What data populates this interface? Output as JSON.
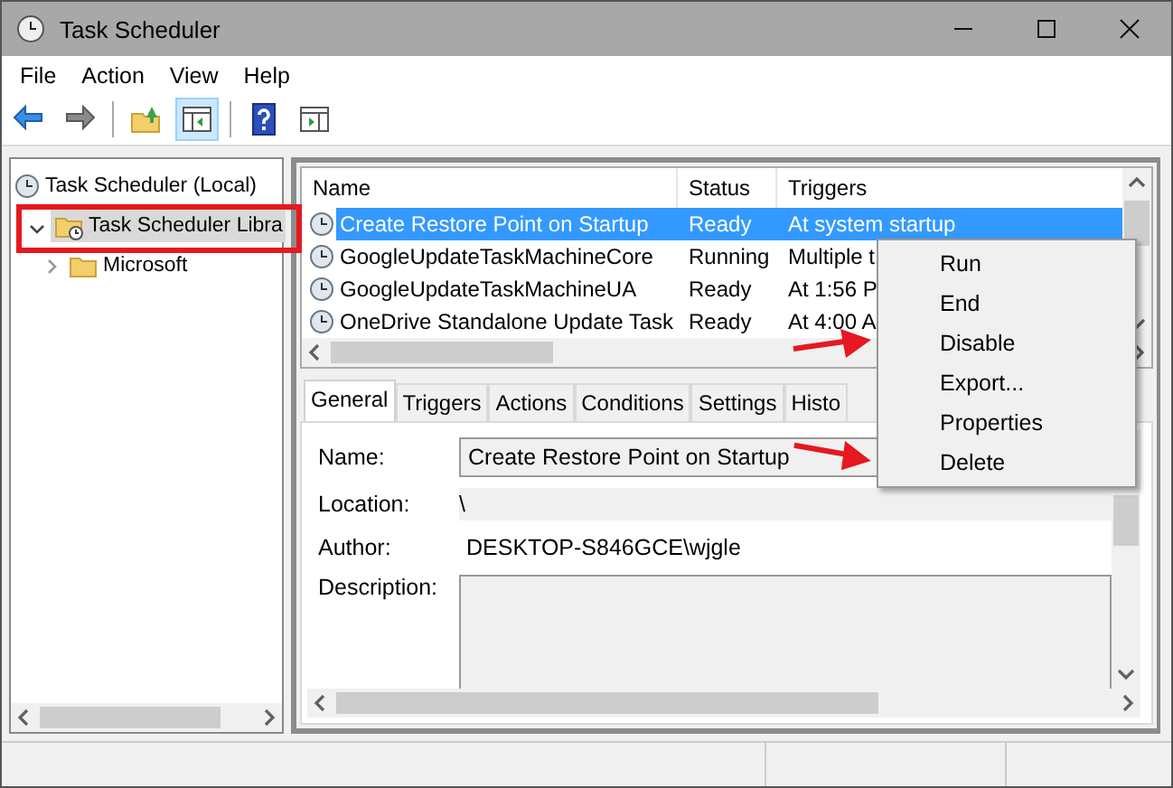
{
  "window": {
    "title": "Task Scheduler"
  },
  "menu_bar": [
    "File",
    "Action",
    "View",
    "Help"
  ],
  "toolbar": [
    {
      "kind": "back",
      "pressed": false
    },
    {
      "kind": "forward",
      "pressed": false
    },
    {
      "kind": "up",
      "pressed": false
    },
    {
      "kind": "tree",
      "pressed": true
    },
    {
      "kind": "help",
      "pressed": false
    },
    {
      "kind": "actions",
      "pressed": false
    }
  ],
  "tree": [
    {
      "label": "Task Scheduler (Local)",
      "kind": "root",
      "selected": false,
      "children": [
        {
          "label": "Task Scheduler Libra",
          "kind": "library",
          "expanded": true,
          "selected": true,
          "children": [
            {
              "label": "Microsoft",
              "kind": "folder",
              "expanded": false,
              "selected": false
            }
          ]
        }
      ]
    }
  ],
  "task_list": {
    "columns": [
      "Name",
      "Status",
      "Triggers"
    ],
    "rows": [
      {
        "name": "Create Restore Point on Startup",
        "status": "Ready",
        "triggers": "At system startup",
        "selected": true
      },
      {
        "name": "GoogleUpdateTaskMachineCore",
        "status": "Running",
        "triggers": "Multiple t",
        "selected": false
      },
      {
        "name": "GoogleUpdateTaskMachineUA",
        "status": "Ready",
        "triggers": "At 1:56 P",
        "selected": false
      },
      {
        "name": "OneDrive Standalone Update Task",
        "status": "Ready",
        "triggers": "At 4:00 A",
        "selected": false
      }
    ]
  },
  "details": {
    "tabs": [
      {
        "label": "General",
        "selected": true
      },
      {
        "label": "Triggers",
        "selected": false
      },
      {
        "label": "Actions",
        "selected": false
      },
      {
        "label": "Conditions",
        "selected": false
      },
      {
        "label": "Settings",
        "selected": false
      },
      {
        "label": "Histo",
        "selected": false
      }
    ],
    "fields": [
      {
        "kind": "field",
        "label": "Name:",
        "value": "Create Restore Point on Startup"
      },
      {
        "kind": "band",
        "label": "Location:",
        "value": "\\"
      },
      {
        "kind": "text",
        "label": "Author:",
        "value": "DESKTOP-S846GCE\\wjgle"
      },
      {
        "kind": "area",
        "label": "Description:"
      }
    ]
  },
  "context_menu": [
    "Run",
    "End",
    "Disable",
    "Export...",
    "Properties",
    "Delete"
  ],
  "annotations": [
    {
      "kind": "highlight"
    },
    {
      "kind": "arrow"
    },
    {
      "kind": "arrow"
    }
  ]
}
